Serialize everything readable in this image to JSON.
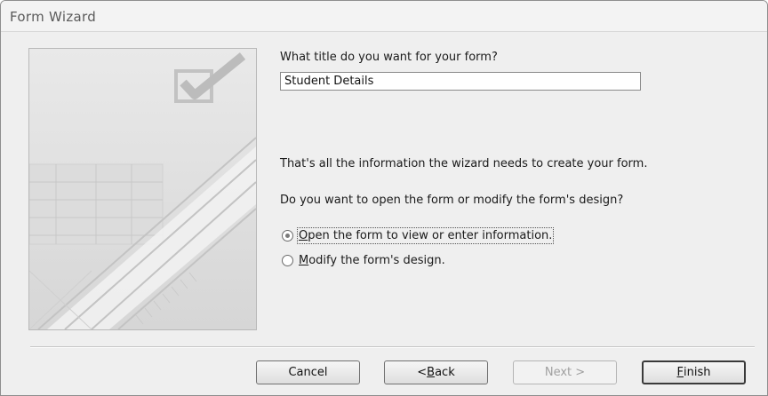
{
  "window": {
    "title": "Form Wizard"
  },
  "form_title": {
    "question": "What title do you want for your form?",
    "value": "Student Details"
  },
  "info_text": "That's all the information the wizard needs to create your form.",
  "open_question": "Do you want to open the form or modify the form's design?",
  "options": [
    {
      "mnemonic": "O",
      "rest": "pen the form to view or enter information.",
      "selected": true
    },
    {
      "mnemonic": "M",
      "rest": "odify the form's design.",
      "selected": false
    }
  ],
  "buttons": {
    "cancel": {
      "label": "Cancel"
    },
    "back": {
      "prefix": "< ",
      "mnemonic": "B",
      "rest": "ack"
    },
    "next": {
      "label": "Next >",
      "enabled": false
    },
    "finish": {
      "mnemonic": "F",
      "rest": "inish"
    }
  },
  "icons": {
    "side_image": "checkmark-wizard-graphic"
  }
}
